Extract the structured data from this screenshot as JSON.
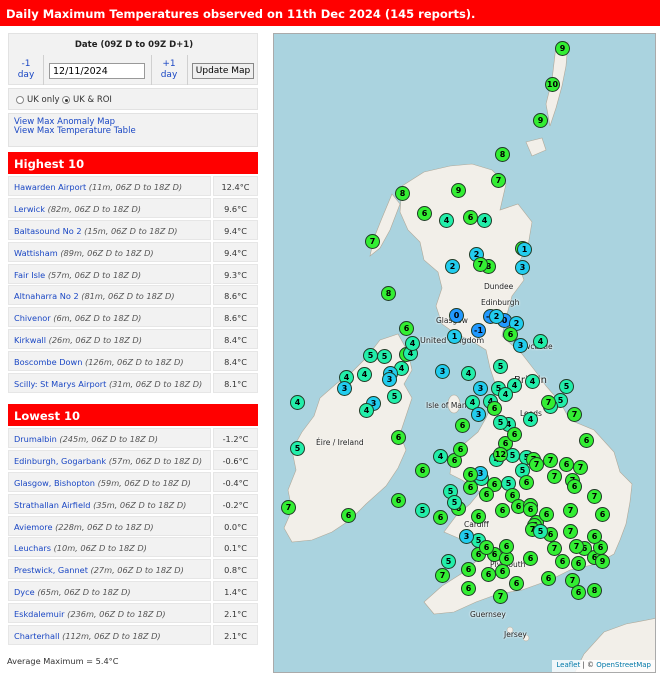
{
  "title": "Daily Maximum Temperatures observed on 11th Dec 2024 (145 reports).",
  "date_panel": {
    "label": "Date (09Z D to 09Z D+1)",
    "prev_label": "-1\nday",
    "next_label": "+1\nday",
    "date_value": "12/11/2024",
    "update_label": "Update Map"
  },
  "region_options": [
    {
      "label": "UK only",
      "selected": false
    },
    {
      "label": "UK & ROI",
      "selected": true
    }
  ],
  "links": [
    "View Max Anomaly Map",
    "View Max Temperature Table"
  ],
  "highest": {
    "heading": "Highest 10",
    "rows": [
      {
        "station": "Hawarden Airport",
        "info": "(11m, 06Z D to 18Z D)",
        "value": "12.4°C"
      },
      {
        "station": "Lerwick",
        "info": "(82m, 06Z D to 18Z D)",
        "value": "9.6°C"
      },
      {
        "station": "Baltasound No 2",
        "info": "(15m, 06Z D to 18Z D)",
        "value": "9.4°C"
      },
      {
        "station": "Wattisham",
        "info": "(89m, 06Z D to 18Z D)",
        "value": "9.4°C"
      },
      {
        "station": "Fair Isle",
        "info": "(57m, 06Z D to 18Z D)",
        "value": "9.3°C"
      },
      {
        "station": "Altnaharra No 2",
        "info": "(81m, 06Z D to 18Z D)",
        "value": "8.6°C"
      },
      {
        "station": "Chivenor",
        "info": "(6m, 06Z D to 18Z D)",
        "value": "8.6°C"
      },
      {
        "station": "Kirkwall",
        "info": "(26m, 06Z D to 18Z D)",
        "value": "8.4°C"
      },
      {
        "station": "Boscombe Down",
        "info": "(126m, 06Z D to 18Z D)",
        "value": "8.4°C"
      },
      {
        "station": "Scilly: St Marys Airport",
        "info": "(31m, 06Z D to 18Z D)",
        "value": "8.1°C"
      }
    ]
  },
  "lowest": {
    "heading": "Lowest 10",
    "rows": [
      {
        "station": "Drumalbin",
        "info": "(245m, 06Z D to 18Z D)",
        "value": "-1.2°C"
      },
      {
        "station": "Edinburgh, Gogarbank",
        "info": "(57m, 06Z D to 18Z D)",
        "value": "-0.6°C"
      },
      {
        "station": "Glasgow, Bishopton",
        "info": "(59m, 06Z D to 18Z D)",
        "value": "-0.4°C"
      },
      {
        "station": "Strathallan Airfield",
        "info": "(35m, 06Z D to 18Z D)",
        "value": "-0.2°C"
      },
      {
        "station": "Aviemore",
        "info": "(228m, 06Z D to 18Z D)",
        "value": "0.0°C"
      },
      {
        "station": "Leuchars",
        "info": "(10m, 06Z D to 18Z D)",
        "value": "0.1°C"
      },
      {
        "station": "Prestwick, Gannet",
        "info": "(27m, 06Z D to 18Z D)",
        "value": "0.8°C"
      },
      {
        "station": "Dyce",
        "info": "(65m, 06Z D to 18Z D)",
        "value": "1.4°C"
      },
      {
        "station": "Eskdalemuir",
        "info": "(236m, 06Z D to 18Z D)",
        "value": "2.1°C"
      },
      {
        "station": "Charterhall",
        "info": "(112m, 06Z D to 18Z D)",
        "value": "2.1°C"
      }
    ]
  },
  "average": "Average Maximum = 5.4°C",
  "map": {
    "place_labels": [
      "Edinburgh",
      "Glasgow",
      "Dundee",
      "United Kingdom",
      "Newcastle",
      "Britain",
      "Isle of Man",
      "Leeds",
      "Éire / Ireland",
      "Cardiff",
      "Plymouth",
      "Guernsey",
      "Jersey"
    ],
    "attribution_lib": "Leaflet",
    "attribution_sep": " | © ",
    "attribution_src": "OpenStreetMap",
    "colors": {
      "sea": "#aad3df",
      "land": "#f2efe9",
      "green_marker": "#33ee33",
      "teal_marker": "#22eeaa",
      "cyan_marker": "#22ccee",
      "blue_marker": "#2299ff",
      "header_red": "#ff0000"
    },
    "markers": [
      "10",
      "9",
      "9",
      "8",
      "8",
      "7",
      "9",
      "6",
      "4",
      "6",
      "4",
      "7",
      "8",
      "2",
      "2",
      "7",
      "8",
      "1",
      "3",
      "7",
      "0",
      "0",
      "-1",
      "-1",
      "6",
      "2",
      "2",
      "1",
      "4",
      "3",
      "6",
      "5",
      "5",
      "6",
      "4",
      "4",
      "4",
      "3",
      "4",
      "3",
      "5",
      "4",
      "3",
      "3",
      "4",
      "4",
      "4",
      "3",
      "5",
      "3",
      "4",
      "4",
      "5",
      "4",
      "4",
      "5",
      "5",
      "4",
      "6",
      "4",
      "3",
      "4",
      "7",
      "4",
      "5",
      "7",
      "5",
      "6",
      "5",
      "6",
      "4",
      "6",
      "5",
      "4",
      "7",
      "6",
      "3",
      "6",
      "6",
      "6",
      "12",
      "6",
      "7",
      "7",
      "7",
      "6",
      "6",
      "7",
      "5",
      "7",
      "6",
      "4",
      "6",
      "6",
      "5",
      "5",
      "6",
      "6",
      "6",
      "7",
      "7",
      "7",
      "7",
      "7",
      "6",
      "6",
      "6",
      "5",
      "7",
      "6",
      "6",
      "6",
      "6",
      "5",
      "6",
      "6",
      "5",
      "5",
      "6",
      "7",
      "6",
      "6",
      "6",
      "7",
      "6",
      "9",
      "3",
      "6",
      "6",
      "6",
      "6",
      "6",
      "6",
      "7",
      "6",
      "5",
      "6",
      "6",
      "6",
      "6",
      "6",
      "6",
      "7",
      "6",
      "8",
      "7",
      "7",
      "7",
      "6",
      "6"
    ]
  }
}
